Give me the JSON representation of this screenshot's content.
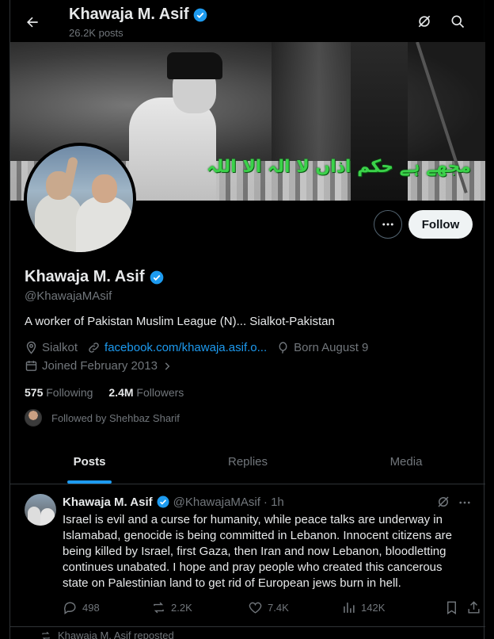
{
  "header": {
    "name": "Khawaja M. Asif",
    "posts": "26.2K posts"
  },
  "banner": {
    "urdu_text": "مجھے ہے حکم اذاں لا الہ الا اللہ"
  },
  "profile": {
    "name": "Khawaja M. Asif",
    "handle": "@KhawajaMAsif",
    "bio": "A worker of Pakistan Muslim League (N)... Sialkot-Pakistan",
    "location": "Sialkot",
    "website": "facebook.com/khawaja.asif.o...",
    "birthday": "Born August 9",
    "joined": "Joined February 2013",
    "following_count": "575",
    "following_label": "Following",
    "followers_count": "2.4M",
    "followers_label": "Followers",
    "followed_by": "Followed by Shehbaz Sharif",
    "follow_label": "Follow"
  },
  "tabs": [
    {
      "label": "Posts",
      "active": true
    },
    {
      "label": "Replies",
      "active": false
    },
    {
      "label": "Media",
      "active": false
    }
  ],
  "tweet": {
    "name": "Khawaja M. Asif",
    "handle": "@KhawajaMAsif",
    "time": "· 1h",
    "text": "Israel is evil and a curse for humanity, while peace talks are underway in Islamabad, genocide is being committed in Lebanon. Innocent citizens are being killed by Israel, first Gaza, then Iran and now Lebanon, bloodletting continues unabated. I hope and pray people who created this cancerous state on Palestinian land to get rid of European jews burn in hell.",
    "replies": "498",
    "reposts": "2.2K",
    "likes": "7.4K",
    "views": "142K"
  },
  "next_item": {
    "repost_text": "Khawaja M. Asif reposted"
  },
  "colors": {
    "accent": "#1d9bf0",
    "verified": "#1d9bf0",
    "muted": "#71767b",
    "background": "#000000"
  }
}
